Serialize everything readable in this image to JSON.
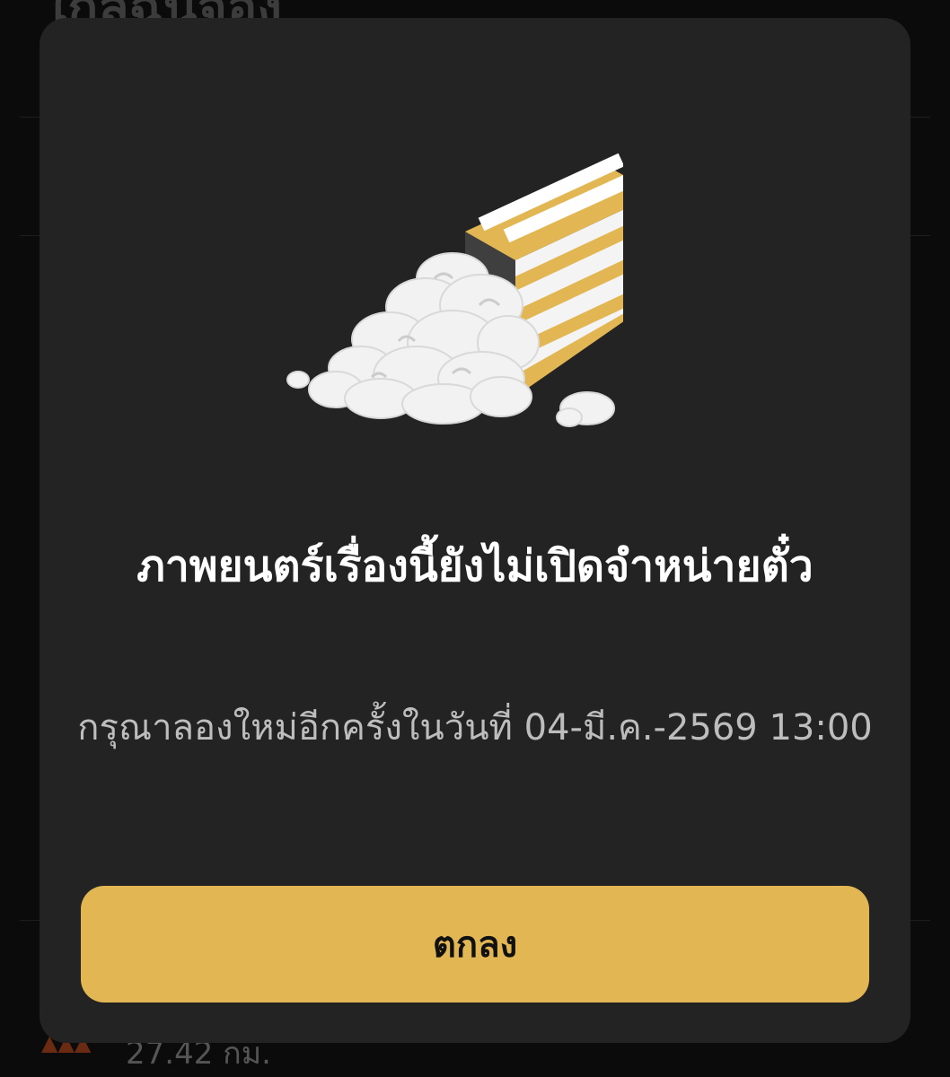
{
  "background": {
    "title_partial": "ใกล้ฉันจอง",
    "footer_distance": "27.42 กม."
  },
  "modal": {
    "illustration": "popcorn-box-spilled-icon",
    "title": "ภาพยนตร์เรื่องนี้ยังไม่เปิดจำหน่ายตั๋ว",
    "subtitle": "กรุณาลองใหม่อีกครั้งในวันที่ 04-มี.ค.-2569 13:00",
    "ok_label": "ตกลง"
  },
  "colors": {
    "modal_bg": "#232323",
    "accent": "#e2b753",
    "title_text": "#ffffff",
    "subtitle_text": "#bdbdbd"
  }
}
